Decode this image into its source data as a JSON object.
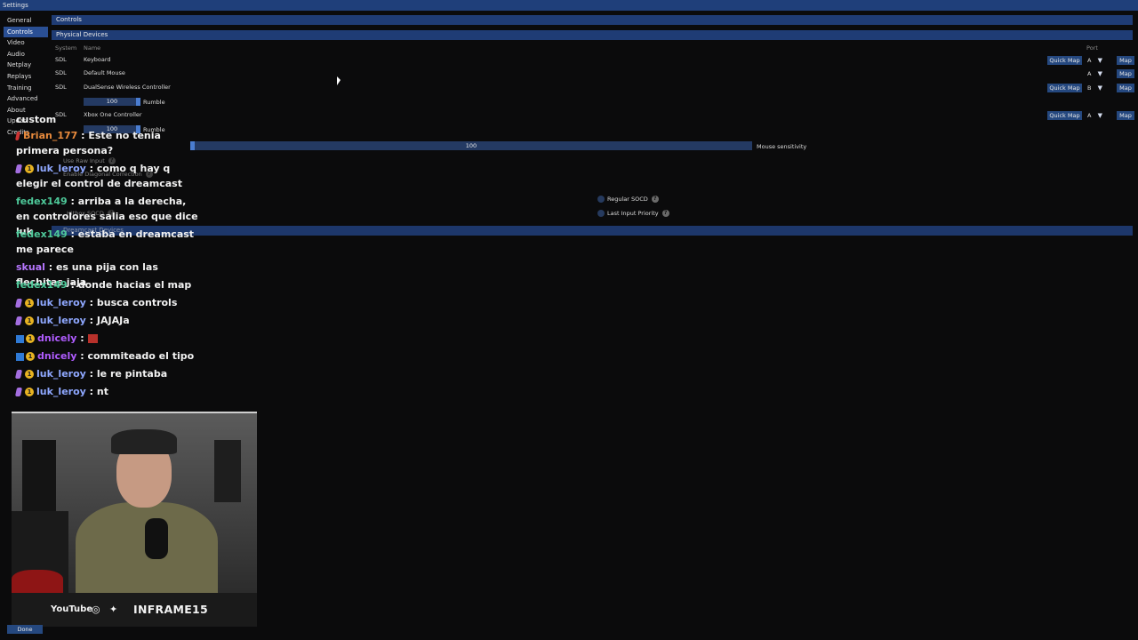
{
  "window": {
    "title": "Settings"
  },
  "sidebar": {
    "items": [
      {
        "label": "General"
      },
      {
        "label": "Controls"
      },
      {
        "label": "Video"
      },
      {
        "label": "Audio"
      },
      {
        "label": "Netplay"
      },
      {
        "label": "Replays"
      },
      {
        "label": "Training"
      },
      {
        "label": "Advanced"
      },
      {
        "label": "About"
      },
      {
        "label": "Updat"
      },
      {
        "label": "Credits"
      }
    ]
  },
  "controls": {
    "header": "Controls",
    "physical_devices": {
      "title": "Physical Devices",
      "columns": {
        "system": "System",
        "name": "Name",
        "port": "Port"
      },
      "devices": [
        {
          "system": "SDL",
          "name": "Keyboard",
          "quick_map": "Quick Map",
          "port": "A",
          "map": "Map"
        },
        {
          "system": "SDL",
          "name": "Default Mouse",
          "quick_map": "",
          "port": "A",
          "map": "Map"
        },
        {
          "system": "SDL",
          "name": "DualSense Wireless Controller",
          "quick_map": "Quick Map",
          "port": "B",
          "map": "Map",
          "rumble_value": "100",
          "rumble_label": "Rumble"
        },
        {
          "system": "SDL",
          "name": "Xbox One Controller",
          "quick_map": "Quick Map",
          "port": "A",
          "map": "Map",
          "rumble_value": "100",
          "rumble_label": "Rumble"
        }
      ]
    },
    "mouse_sensitivity": {
      "value": "100",
      "label": "Mouse sensitivity",
      "level": 0.0
    },
    "options": {
      "use_raw_input": "Use Raw Input",
      "enable_diagonal_correction": "Enable Diagonal Correction",
      "hitbox_socd": "Hitbox SOCD",
      "regular_socd": "Regular SOCD",
      "last_input_priority": "Last Input Priority"
    },
    "dreamcast_devices": {
      "title": "Dreamcast Devices"
    }
  },
  "chat": {
    "messages": [
      {
        "user": "",
        "text": "custom",
        "user_color": "#ffffff"
      },
      {
        "user": "Brian_177",
        "text": ": Este no tenia primera persona?",
        "user_color": "#e88a3c"
      },
      {
        "user": "luk_leroy",
        "text": ": como q hay q elegir el control de dreamcast",
        "user_color": "#8fa8ff"
      },
      {
        "user": "fedex149",
        "text": ": arriba a la derecha, en controlores salia eso que dice luk",
        "user_color": "#4ec99a"
      },
      {
        "user": "fedex149",
        "text": ": estaba en dreamcast me parece",
        "user_color": "#4ec99a"
      },
      {
        "user": "skual",
        "text": ": es una pija con las flechitas jaja",
        "user_color": "#b777ff"
      },
      {
        "user": "fedex149",
        "text": ": donde hacias el map",
        "user_color": "#4ec99a"
      },
      {
        "user": "luk_leroy",
        "text": ": busca controls",
        "user_color": "#8fa8ff"
      },
      {
        "user": "luk_leroy",
        "text": ": JAJAJa",
        "user_color": "#8fa8ff"
      },
      {
        "user": "dnicely",
        "text": ":",
        "user_color": "#b05cff"
      },
      {
        "user": "dnicely",
        "text": ": commiteado el tipo",
        "user_color": "#b05cff"
      },
      {
        "user": "luk_leroy",
        "text": ": le re pintaba",
        "user_color": "#8fa8ff"
      },
      {
        "user": "luk_leroy",
        "text": ": nt",
        "user_color": "#8fa8ff"
      }
    ]
  },
  "stream_banner": {
    "youtube": "YouTube",
    "channel_name": "INFRAME15"
  },
  "footer": {
    "done_label": "Done"
  }
}
